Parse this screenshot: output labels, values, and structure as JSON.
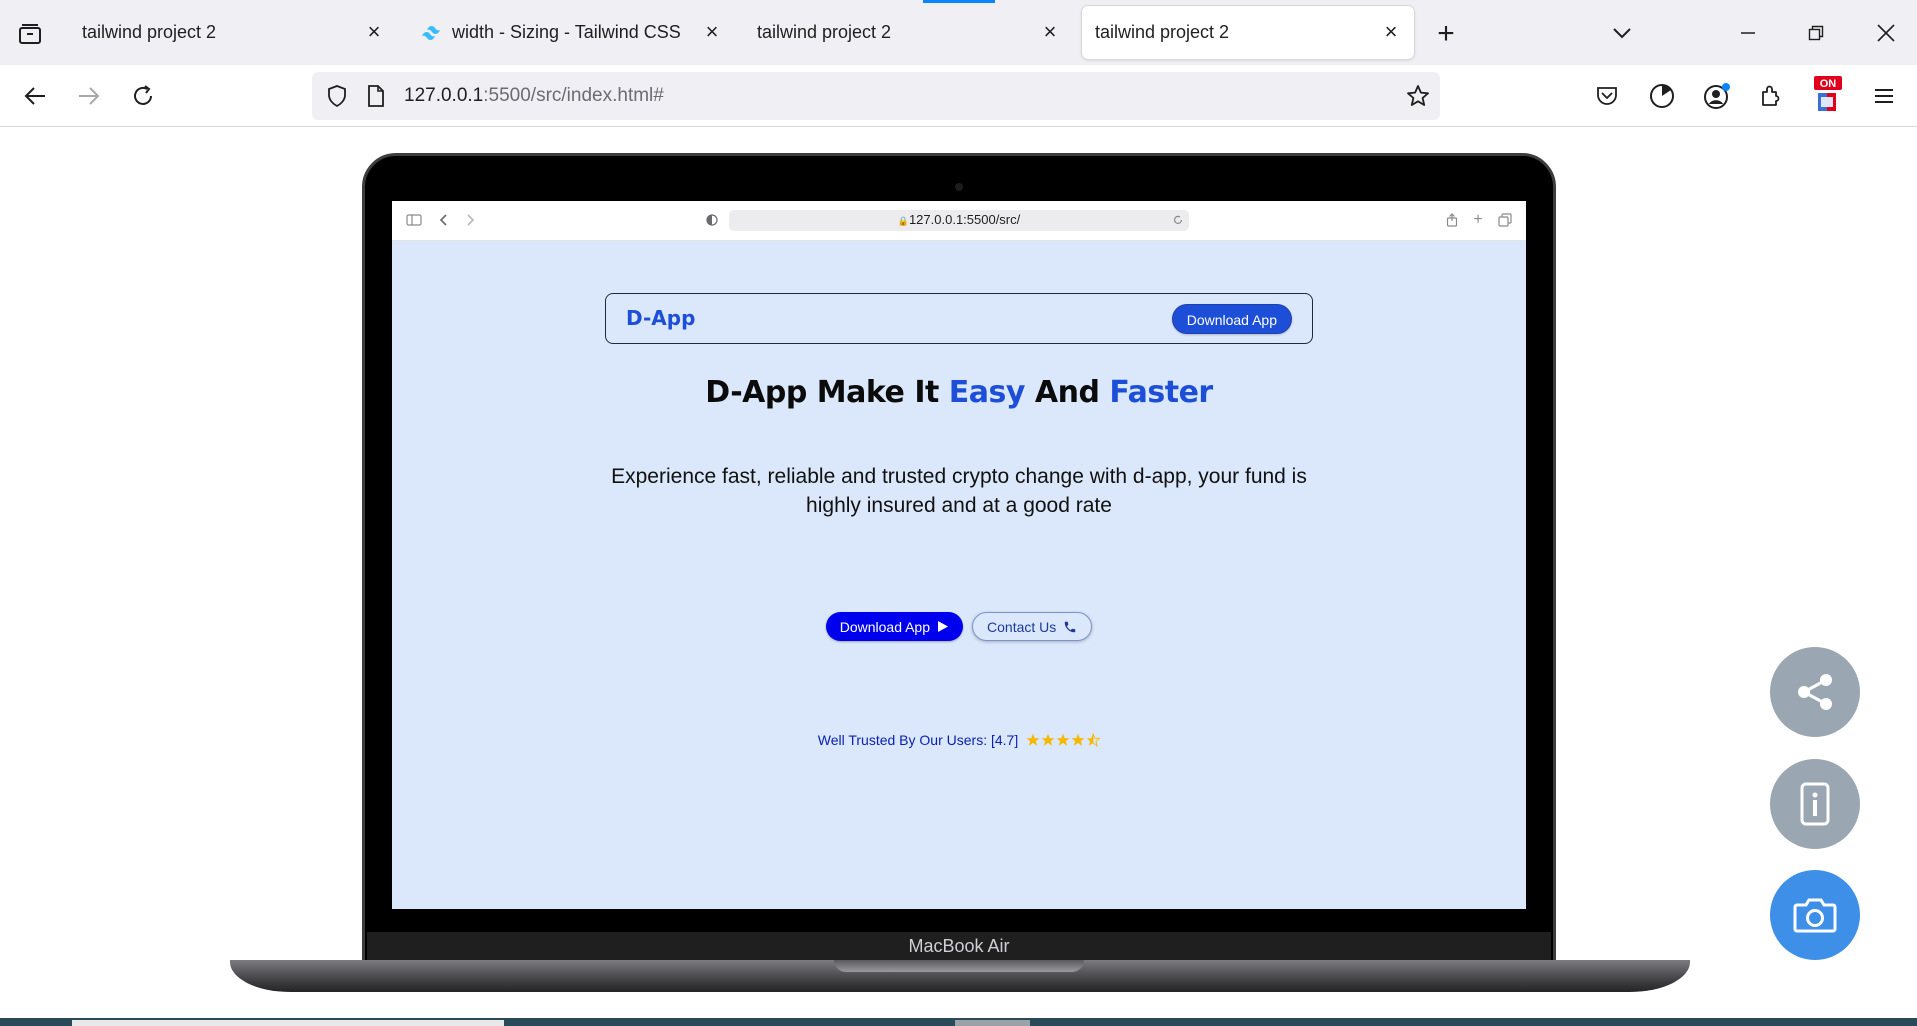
{
  "browser": {
    "tabs": [
      {
        "title": "tailwind project 2",
        "active": false
      },
      {
        "title": "width - Sizing - Tailwind CSS",
        "active": false
      },
      {
        "title": "tailwind project 2",
        "active": false
      },
      {
        "title": "tailwind project 2",
        "active": true
      }
    ],
    "url": {
      "host": "127.0.0.1",
      "rest": ":5500/src/index.html#"
    }
  },
  "mockup": {
    "device_label": "MacBook Air",
    "safari_url": "127.0.0.1:5500/src/"
  },
  "site": {
    "logo": "D-App",
    "nav_button": "Download App",
    "hero": {
      "part1": "D-App Make It ",
      "highlight1": "Easy",
      "part2": " And ",
      "highlight2": "Faster"
    },
    "subtitle": "Experience fast, reliable and trusted crypto change with d-app, your fund is highly insured and at a good rate",
    "cta_primary": "Download App",
    "cta_secondary": "Contact Us",
    "trust_text": "Well Trusted By Our Users: [4.7]",
    "rating": 4.7,
    "rating_max": 5
  },
  "colors": {
    "accent": "#1d4ed8",
    "screen_bg": "#dbe8fb",
    "star": "#f5b800"
  },
  "fabs": [
    "share-icon",
    "mobile-info-icon",
    "camera-icon"
  ]
}
